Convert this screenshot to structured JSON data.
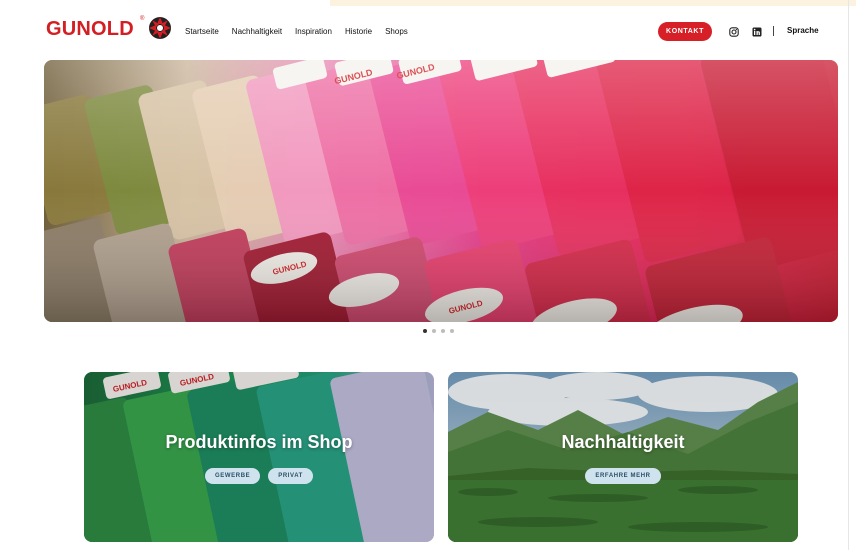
{
  "brand": {
    "logo_text": "GUNOLD",
    "logo_reg": "®",
    "color": "#d31f24"
  },
  "nav": {
    "items": [
      {
        "label": "Startseite"
      },
      {
        "label": "Nachhaltigkeit"
      },
      {
        "label": "Inspiration"
      },
      {
        "label": "Historie"
      },
      {
        "label": "Shops"
      }
    ]
  },
  "header": {
    "contact_label": "KONTAKT",
    "language_label": "Sprache",
    "social_icons": [
      "instagram-icon",
      "linkedin-icon"
    ]
  },
  "hero": {
    "image": "close-up of thread spools in yellow, beige, pink and red",
    "spool_label": "GUNOLD",
    "slide_count": 4,
    "active_slide": 1
  },
  "cards": [
    {
      "title": "Produktinfos im Shop",
      "image": "green, teal and lilac thread spools",
      "buttons": [
        "GEWERBE",
        "PRIVAT"
      ],
      "spool_label": "GUNOLD"
    },
    {
      "title": "Nachhaltigkeit",
      "image": "green mountain valley under cloudy sky",
      "buttons": [
        "ERFAHRE MEHR"
      ]
    }
  ],
  "colors": {
    "accent": "#d61f26",
    "pill_bg": "#cfe3ef",
    "pill_text": "#2a4e66"
  }
}
